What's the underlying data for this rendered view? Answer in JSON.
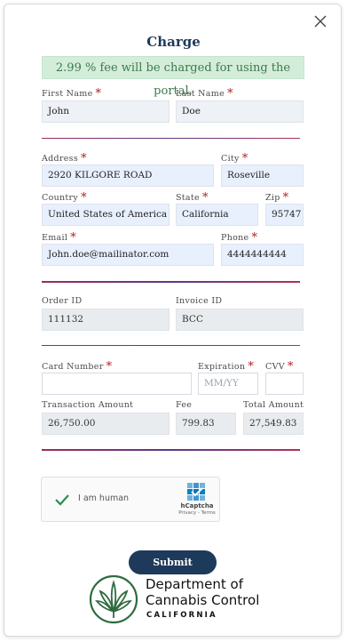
{
  "title": "Charge",
  "notice": "2.99 % fee will be charged for using the portal.",
  "fields": {
    "first_name": {
      "label": "First Name",
      "value": "John"
    },
    "last_name": {
      "label": "Last Name",
      "value": "Doe"
    },
    "address": {
      "label": "Address",
      "value": "2920 KILGORE ROAD"
    },
    "city": {
      "label": "City",
      "value": "Roseville"
    },
    "country": {
      "label": "Country",
      "value": "United States of America"
    },
    "state": {
      "label": "State",
      "value": "California"
    },
    "zip": {
      "label": "Zip",
      "value": "95747"
    },
    "email": {
      "label": "Email",
      "value": "John.doe@mailinator.com"
    },
    "phone": {
      "label": "Phone",
      "value": "4444444444"
    },
    "order_id": {
      "label": "Order ID",
      "value": "111132"
    },
    "invoice_id": {
      "label": "Invoice ID",
      "value": "BCC"
    },
    "card_number": {
      "label": "Card Number",
      "value": ""
    },
    "expiration": {
      "label": "Expiration",
      "placeholder": "MM/YY"
    },
    "cvv": {
      "label": "CVV",
      "value": ""
    },
    "transaction_amount": {
      "label": "Transaction Amount",
      "value": "26,750.00"
    },
    "fee": {
      "label": "Fee",
      "value": "799.83"
    },
    "total_amount": {
      "label": "Total Amount",
      "value": "27,549.83"
    }
  },
  "required_mark": "*",
  "captcha": {
    "label": "I am human",
    "brand": "hCaptcha",
    "links": "Privacy - Terms"
  },
  "submit_label": "Submit",
  "footer": {
    "line1": "Department of",
    "line2": "Cannabis Control",
    "state": "CALIFORNIA"
  },
  "colors": {
    "primary": "#1e3a5a",
    "notice_bg": "#d4edda",
    "required": "#b22222",
    "logo_green": "#2e6b3f"
  }
}
